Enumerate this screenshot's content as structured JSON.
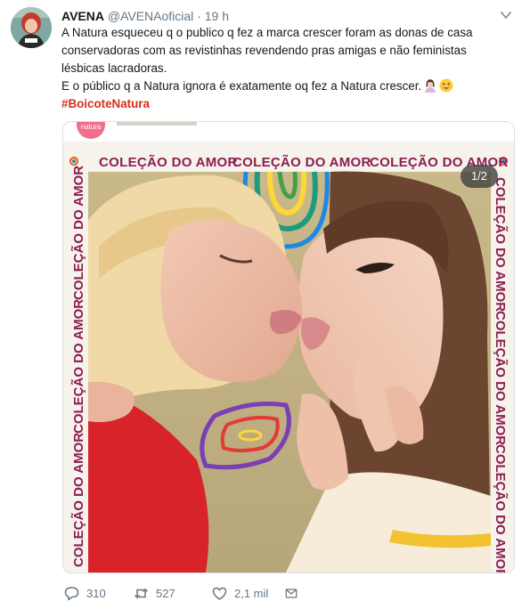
{
  "tweet": {
    "display_name": "AVENA",
    "handle": "@AVENAoficial",
    "separator": "·",
    "time": "19 h",
    "body_text": "A Natura esqueceu q o publico q fez a marca crescer foram as donas de casa conservadoras com as revistinhas revendendo pras amigas e não feministas lésbicas lacradoras.\nE o público q a Natura ignora é exatamente oq fez a Natura crescer.",
    "emojis": [
      "woman-gesturing-emoji",
      "grinning-face-emoji"
    ],
    "hashtag": "#BoicoteNatura",
    "media": {
      "counter": "1/2",
      "frame_text": "COLEÇÃO DO AMOR",
      "brand_badge": "natura",
      "rainbow": [
        "#e53935",
        "#fb8c00",
        "#fdd835",
        "#43a047",
        "#1e88e5",
        "#8e24aa"
      ]
    },
    "stats": {
      "replies": "310",
      "retweets": "527",
      "likes": "2,1 mil"
    }
  },
  "colors": {
    "text": "#14171a",
    "muted": "#657786",
    "hashtag": "#d4311a",
    "frame_text": "#8b1e4f"
  }
}
